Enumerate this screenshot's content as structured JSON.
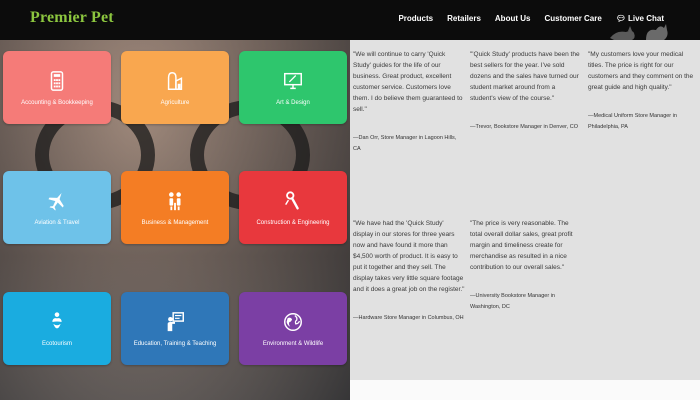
{
  "header": {
    "logo": "Premier Pet",
    "nav": [
      {
        "label": "Products"
      },
      {
        "label": "Retailers"
      },
      {
        "label": "About Us"
      },
      {
        "label": "Customer Care"
      },
      {
        "label": "Live Chat"
      }
    ]
  },
  "tiles": [
    {
      "label": "Accounting & Bookkeeping",
      "color": "#f57b78",
      "icon": "calculator-icon"
    },
    {
      "label": "Agriculture",
      "color": "#f9a74f",
      "icon": "silo-icon"
    },
    {
      "label": "Art & Design",
      "color": "#2ec66d",
      "icon": "monitor-icon"
    },
    {
      "label": "Aviation & Travel",
      "color": "#6ec2e9",
      "icon": "airplane-icon"
    },
    {
      "label": "Business & Management",
      "color": "#f47d24",
      "icon": "business-people-icon"
    },
    {
      "label": "Construction & Engineering",
      "color": "#e8383d",
      "icon": "wrench-icon"
    },
    {
      "label": "Ecotourism",
      "color": "#1aace0",
      "icon": "leaf-person-icon"
    },
    {
      "label": "Education, Training & Teaching",
      "color": "#2f77b8",
      "icon": "teacher-icon"
    },
    {
      "label": "Environment & Wildlife",
      "color": "#7b3fa4",
      "icon": "globe-icon"
    }
  ],
  "testimonials": [
    {
      "quote": "\"We will continue to carry 'Quick Study' guides for the life of our business. Great product, excellent customer service. Customers love them. I do believe them guaranteed to sell.\"",
      "attribution": "—Dan Orr, Store Manager in Lagoon Hills, CA"
    },
    {
      "quote": "\"'Quick Study' products have been the best sellers for the year. I've sold dozens and the sales have turned our student market around from a student's view of the course.\"",
      "attribution": "—Trevor, Bookstore Manager in Denver, CO"
    },
    {
      "quote": "\"My customers love your medical titles. The price is right for our customers and they comment on the great guide and high quality.\"",
      "attribution": "—Medical Uniform Store Manager in Philadelphia, PA"
    },
    {
      "quote": "\"We have had the 'Quick Study' display in our stores for three years now and have found it more than $4,500 worth of product. It is easy to put it together and they sell. The display takes very little square footage and it does a great job on the register.\"",
      "attribution": "—Hardware Store Manager in Columbus, OH"
    },
    {
      "quote": "\"The price is very reasonable. The total overall dollar sales, great profit margin and timeliness create for merchandise as resulted in a nice contribution to our overall sales.\"",
      "attribution": "—University Bookstore Manager in Washington, DC"
    }
  ]
}
